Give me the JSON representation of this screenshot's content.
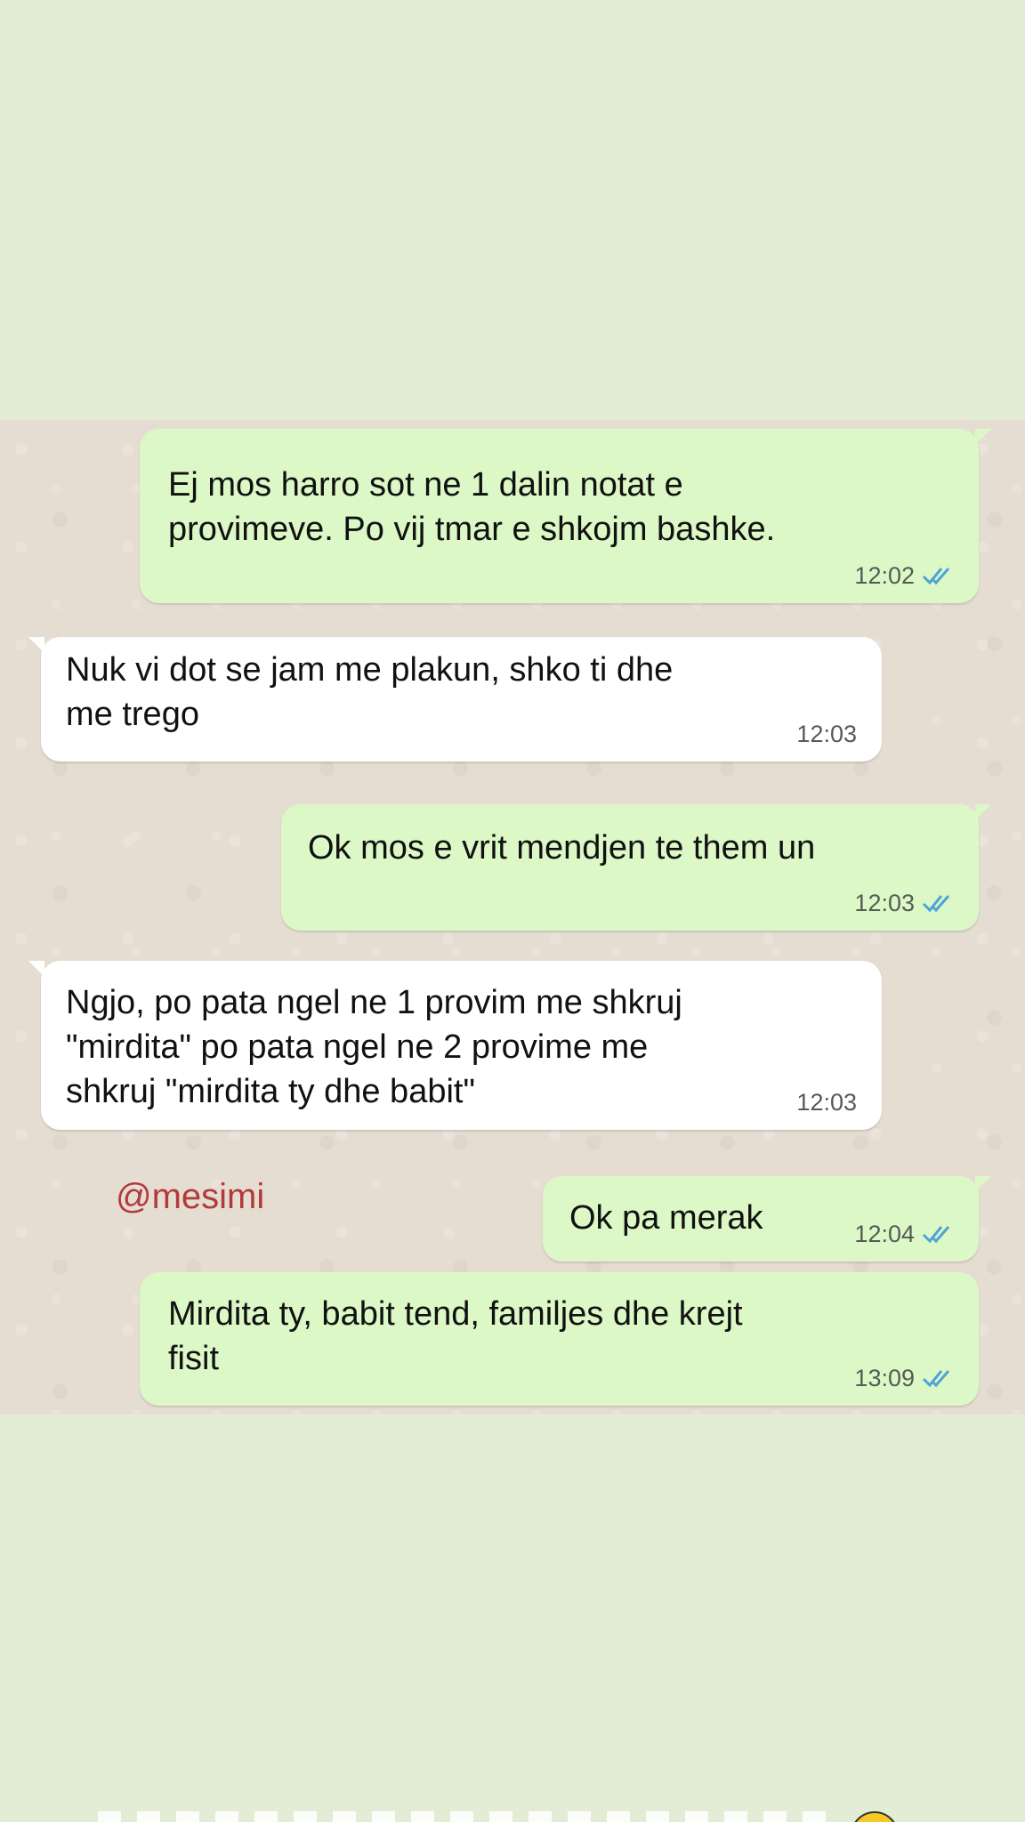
{
  "messages": [
    {
      "direction": "out",
      "text": "Ej mos harro sot ne 1 dalin notat e\nprovimeve. Po vij tmar e shkojm bashke.",
      "time": "12:02",
      "read": true
    },
    {
      "direction": "in",
      "text": "Nuk vi dot se jam me plakun, shko ti dhe\nme trego",
      "time": "12:03"
    },
    {
      "direction": "out",
      "text": "Ok mos e vrit mendjen te them un",
      "time": "12:03",
      "read": true
    },
    {
      "direction": "in",
      "text": "Ngjo, po pata ngel ne 1 provim me shkruj\n\"mirdita\" po pata ngel ne 2 provime me\nshkruj \"mirdita ty dhe babit\"",
      "time": "12:03"
    },
    {
      "direction": "out",
      "text": "Ok pa merak",
      "time": "12:04",
      "read": true
    },
    {
      "direction": "out",
      "text": "Mirdita ty, babit tend, familjes dhe krejt\nfisit",
      "time": "13:09",
      "read": true
    }
  ],
  "watermark": "@mesimi",
  "colors": {
    "page_background": "#e3ecd5",
    "chat_background": "#e6ddd2",
    "outgoing_bubble": "#dcf8c6",
    "incoming_bubble": "#ffffff",
    "read_ticks": "#4fa3d9",
    "watermark": "#b23a3a"
  },
  "icons": {
    "read_receipt": "double-check-icon"
  }
}
